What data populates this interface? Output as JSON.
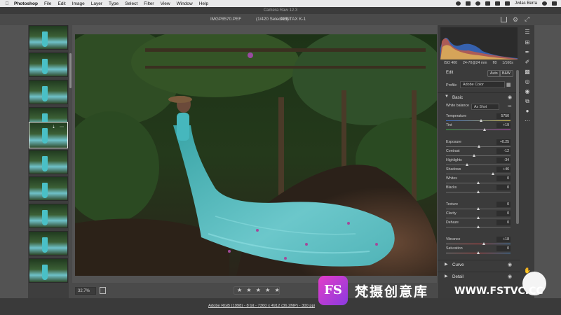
{
  "menubar": {
    "app_name": "Photoshop",
    "items": [
      "File",
      "Edit",
      "Image",
      "Layer",
      "Type",
      "Select",
      "Filter",
      "View",
      "Window",
      "Help"
    ],
    "user": "Jvdas Berra"
  },
  "window": {
    "title": "Camera Raw 12.3"
  },
  "filebar": {
    "filename": "IMGP8570.PEF",
    "selection": "(1/420 Selected)",
    "camera": "- PENTAX K-1"
  },
  "filmstrip": {
    "thumb_count": 10,
    "selected_index": 4
  },
  "histogram": {
    "iso": "ISO 400",
    "lens": "24-70@24 mm",
    "aperture": "f/8",
    "shutter": "1/160s"
  },
  "panel": {
    "edit_label": "Edit",
    "auto_label": "Auto",
    "bw_label": "B&W",
    "profile_label": "Profile",
    "profile_value": "Adobe Color",
    "basic_section": "Basic",
    "white_balance_label": "White balance",
    "white_balance_value": "As Shot",
    "sliders": [
      {
        "label": "Temperature",
        "value": "5750",
        "pos": 0.55
      },
      {
        "label": "Tint",
        "value": "+19",
        "pos": 0.6
      },
      {
        "label": "Exposure",
        "value": "+0.25",
        "pos": 0.52
      },
      {
        "label": "Contrast",
        "value": "-12",
        "pos": 0.44
      },
      {
        "label": "Highlights",
        "value": "-34",
        "pos": 0.33
      },
      {
        "label": "Shadows",
        "value": "+46",
        "pos": 0.73
      },
      {
        "label": "Whites",
        "value": "0",
        "pos": 0.5
      },
      {
        "label": "Blacks",
        "value": "0",
        "pos": 0.5
      },
      {
        "label": "Texture",
        "value": "0",
        "pos": 0.5
      },
      {
        "label": "Clarity",
        "value": "0",
        "pos": 0.5
      },
      {
        "label": "Dehaze",
        "value": "0",
        "pos": 0.5
      },
      {
        "label": "Vibrance",
        "value": "+18",
        "pos": 0.59
      },
      {
        "label": "Saturation",
        "value": "0",
        "pos": 0.5
      }
    ],
    "curve_section": "Curve",
    "detail_section": "Detail"
  },
  "bottombar": {
    "zoom": "32.7%",
    "rating": "★ ★ ★ ★ ★"
  },
  "footer": {
    "workflow_link": "Adobe RGB (1998) - 8 bit - 7360 x 4912 (36.2MP) - 300 ppi"
  },
  "watermark": {
    "logo": "FS",
    "text": "梵摄创意库",
    "url": "WWW.FSTVC.CC"
  },
  "colors": {
    "panel_bg": "#3b3b3b",
    "toolbar_bg": "#4a4a4a",
    "accent_dress": "#59c6cc",
    "logo_magenta": "#e33cc7"
  }
}
